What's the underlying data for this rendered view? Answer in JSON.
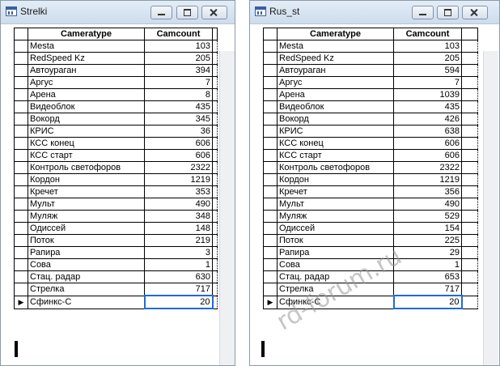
{
  "windows": [
    {
      "title": "Strelki",
      "columns": [
        "Cameratype",
        "Camcount"
      ],
      "rows": [
        [
          "Mesta",
          "103"
        ],
        [
          "RedSpeed Kz",
          "205"
        ],
        [
          "Автоураган",
          "394"
        ],
        [
          "Аргус",
          "7"
        ],
        [
          "Арена",
          "8"
        ],
        [
          "Видеоблок",
          "435"
        ],
        [
          "Вокорд",
          "345"
        ],
        [
          "КРИС",
          "36"
        ],
        [
          "КСС конец",
          "606"
        ],
        [
          "КСС старт",
          "606"
        ],
        [
          "Контроль светофоров",
          "2322"
        ],
        [
          "Кордон",
          "1219"
        ],
        [
          "Кречет",
          "353"
        ],
        [
          "Мульт",
          "490"
        ],
        [
          "Муляж",
          "348"
        ],
        [
          "Одиссей",
          "148"
        ],
        [
          "Поток",
          "219"
        ],
        [
          "Рапира",
          "3"
        ],
        [
          "Сова",
          "1"
        ],
        [
          "Стац. радар",
          "630"
        ],
        [
          "Стрелка",
          "717"
        ],
        [
          "Сфинкс-С",
          "20"
        ]
      ],
      "current_row": 21,
      "current_marker": "▶"
    },
    {
      "title": "Rus_st",
      "columns": [
        "Cameratype",
        "Camcount"
      ],
      "rows": [
        [
          "Mesta",
          "103"
        ],
        [
          "RedSpeed Kz",
          "205"
        ],
        [
          "Автоураган",
          "594"
        ],
        [
          "Аргус",
          "7"
        ],
        [
          "Арена",
          "1039"
        ],
        [
          "Видеоблок",
          "435"
        ],
        [
          "Вокорд",
          "426"
        ],
        [
          "КРИС",
          "638"
        ],
        [
          "КСС конец",
          "606"
        ],
        [
          "КСС старт",
          "606"
        ],
        [
          "Контроль светофоров",
          "2322"
        ],
        [
          "Кордон",
          "1219"
        ],
        [
          "Кречет",
          "356"
        ],
        [
          "Мульт",
          "490"
        ],
        [
          "Муляж",
          "529"
        ],
        [
          "Одиссей",
          "154"
        ],
        [
          "Поток",
          "225"
        ],
        [
          "Рапира",
          "29"
        ],
        [
          "Сова",
          "1"
        ],
        [
          "Стац. радар",
          "653"
        ],
        [
          "Стрелка",
          "717"
        ],
        [
          "Сфинкс-С",
          "20"
        ]
      ],
      "current_row": 21,
      "current_marker": "▶"
    }
  ],
  "watermark": "rd-forum.ru"
}
